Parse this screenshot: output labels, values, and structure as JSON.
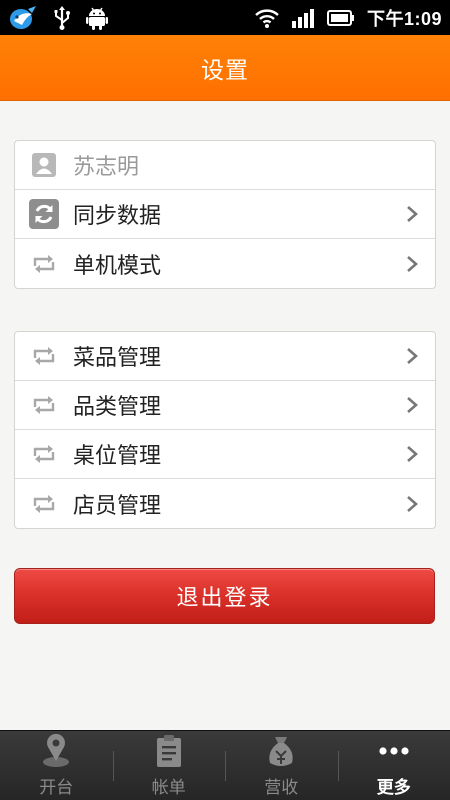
{
  "status_bar": {
    "time": "下午1:09",
    "icons": [
      "app-bird-icon",
      "usb-icon",
      "android-icon",
      "wifi-icon",
      "signal-icon",
      "battery-icon"
    ]
  },
  "header": {
    "title": "设置"
  },
  "account_group": [
    {
      "label": "苏志明",
      "icon": "user-icon",
      "muted": true,
      "has_arrow": false
    },
    {
      "label": "同步数据",
      "icon": "sync-icon",
      "has_arrow": true
    },
    {
      "label": "单机模式",
      "icon": "repeat-icon",
      "has_arrow": true
    }
  ],
  "manage_group": [
    {
      "label": "菜品管理",
      "icon": "repeat-icon",
      "has_arrow": true
    },
    {
      "label": "品类管理",
      "icon": "repeat-icon",
      "has_arrow": true
    },
    {
      "label": "桌位管理",
      "icon": "repeat-icon",
      "has_arrow": true
    },
    {
      "label": "店员管理",
      "icon": "repeat-icon",
      "has_arrow": true
    }
  ],
  "logout_label": "退出登录",
  "tabs": [
    {
      "label": "开台",
      "icon": "location-pin-icon",
      "active": false
    },
    {
      "label": "帐单",
      "icon": "clipboard-icon",
      "active": false
    },
    {
      "label": "营收",
      "icon": "money-bag-icon",
      "active": false
    },
    {
      "label": "更多",
      "icon": "more-icon",
      "active": true
    }
  ],
  "colors": {
    "header": "#ff7a00",
    "logout": "#d93029",
    "tab_bar": "#2f2f2f",
    "background": "#f5f5f3"
  }
}
